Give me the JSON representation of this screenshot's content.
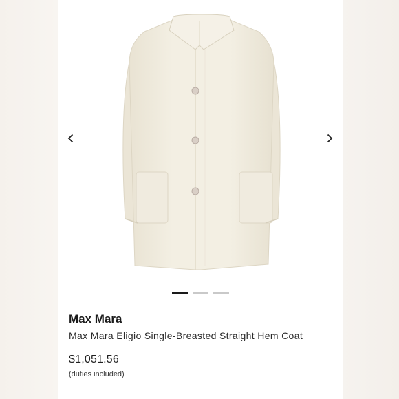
{
  "product": {
    "brand": "Max Mara",
    "name": "Max Mara Eligio Single-Breasted Straight Hem Coat",
    "price": "$1,051.56",
    "duties_note": "(duties included)",
    "coat_color": "#f1ecde"
  },
  "carousel": {
    "prev_icon": "chevron-left-icon",
    "next_icon": "chevron-right-icon",
    "slide_count": 3,
    "active_index": 0
  },
  "colors": {
    "side_panel": "#f6f2ed",
    "active_dot": "#1a1a1a",
    "inactive_dot": "#c9c9c9"
  }
}
